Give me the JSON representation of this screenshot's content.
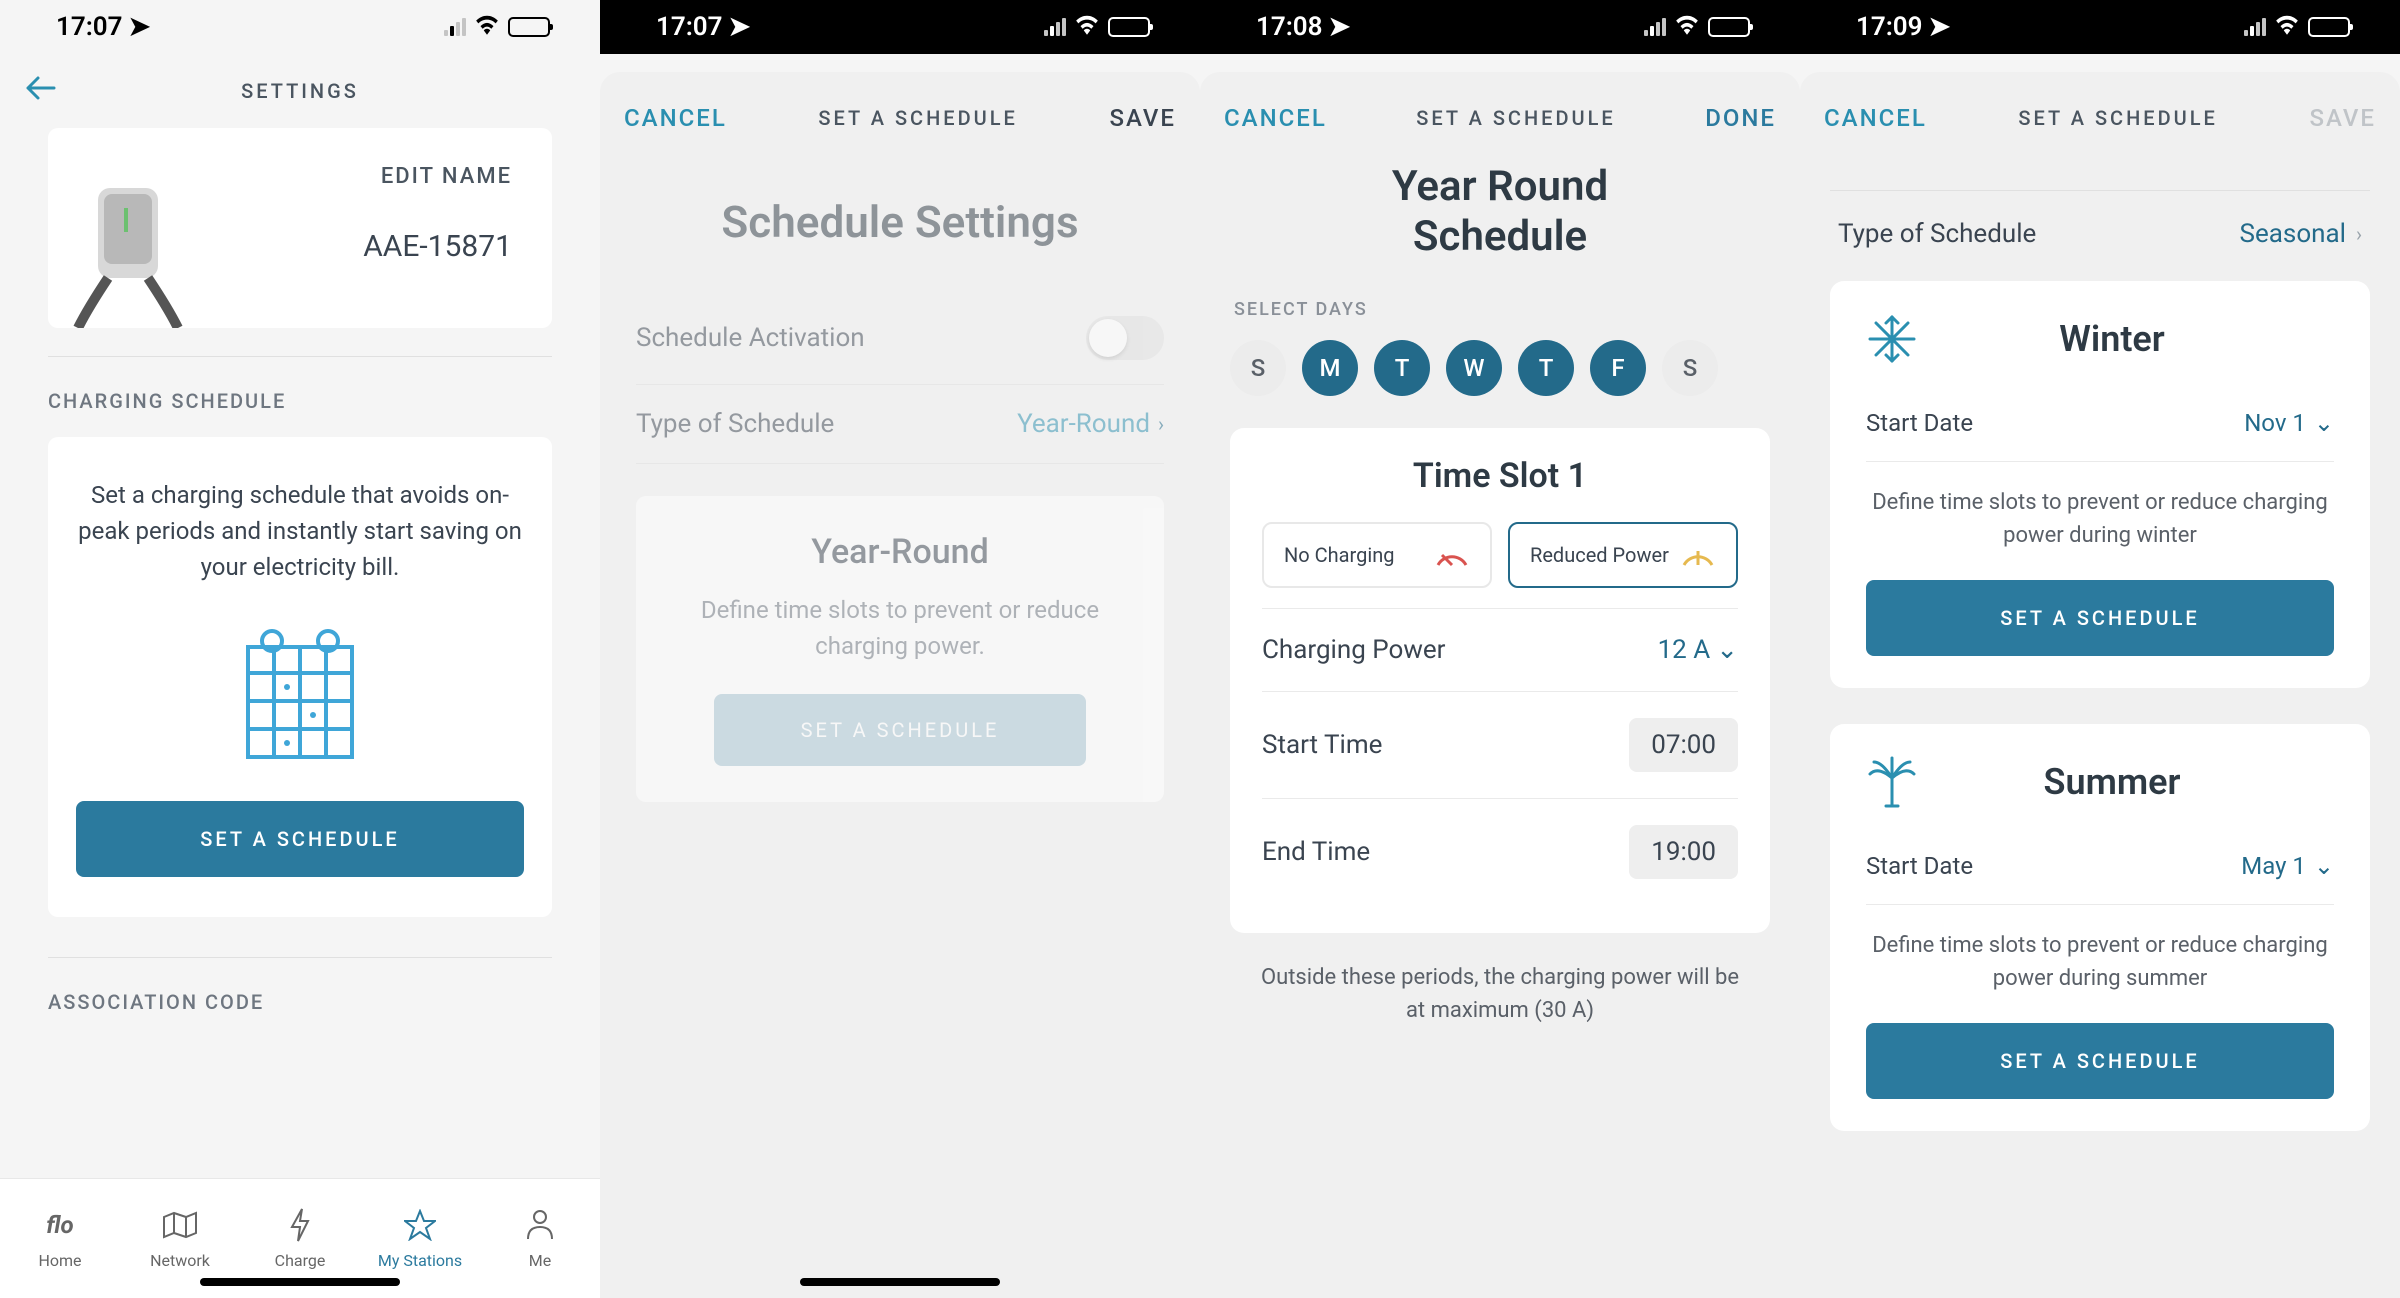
{
  "screen1": {
    "status_time": "17:07",
    "header_title": "SETTINGS",
    "device": {
      "edit_name": "EDIT NAME",
      "name": "AAE-15871"
    },
    "charging_schedule_label": "CHARGING SCHEDULE",
    "schedule_desc": "Set a charging schedule that avoids on-peak periods and instantly start saving on your electricity bill.",
    "set_schedule_btn": "SET A SCHEDULE",
    "association_code_label": "ASSOCIATION CODE",
    "tabs": {
      "home": "Home",
      "network": "Network",
      "charge": "Charge",
      "mystations": "My Stations",
      "me": "Me"
    }
  },
  "screen2": {
    "status_time": "17:07",
    "cancel": "CANCEL",
    "title": "SET A SCHEDULE",
    "save": "SAVE",
    "heading": "Schedule Settings",
    "activation_label": "Schedule Activation",
    "type_label": "Type of Schedule",
    "type_value": "Year-Round",
    "card_title": "Year-Round",
    "card_desc": "Define time slots to prevent or reduce charging power.",
    "card_btn": "SET A SCHEDULE"
  },
  "screen3": {
    "status_time": "17:08",
    "cancel": "CANCEL",
    "title": "SET A SCHEDULE",
    "done": "DONE",
    "heading": "Year Round Schedule",
    "select_days_label": "SELECT DAYS",
    "days": [
      {
        "label": "S",
        "on": false
      },
      {
        "label": "M",
        "on": true
      },
      {
        "label": "T",
        "on": true
      },
      {
        "label": "W",
        "on": true
      },
      {
        "label": "T",
        "on": true
      },
      {
        "label": "F",
        "on": true
      },
      {
        "label": "S",
        "on": false
      }
    ],
    "slot_title": "Time Slot 1",
    "mode_no_charging": "No Charging",
    "mode_reduced": "Reduced Power",
    "charging_power_label": "Charging Power",
    "charging_power_value": "12 A",
    "start_label": "Start Time",
    "start_value": "07:00",
    "end_label": "End Time",
    "end_value": "19:00",
    "footer": "Outside these periods, the charging power will be at maximum (30 A)"
  },
  "screen4": {
    "status_time": "17:09",
    "cancel": "CANCEL",
    "title": "SET A SCHEDULE",
    "save": "SAVE",
    "type_label": "Type of Schedule",
    "type_value": "Seasonal",
    "winter": {
      "title": "Winter",
      "start_date_label": "Start Date",
      "start_date_value": "Nov 1",
      "desc": "Define time slots to prevent or reduce charging power during winter",
      "btn": "SET A SCHEDULE"
    },
    "summer": {
      "title": "Summer",
      "start_date_label": "Start Date",
      "start_date_value": "May 1",
      "desc": "Define time slots to prevent or reduce charging power during summer",
      "btn": "SET A SCHEDULE"
    }
  }
}
